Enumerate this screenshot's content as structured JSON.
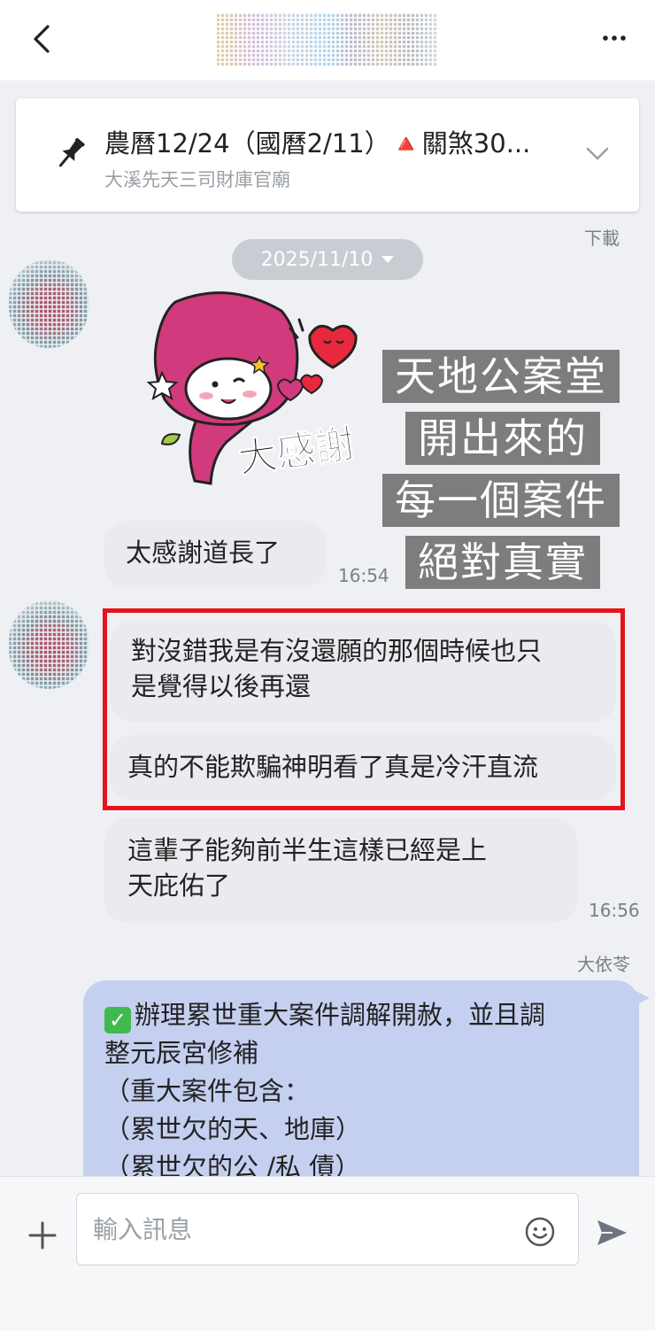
{
  "header": {
    "back_icon": "chevron-left-icon",
    "more_icon": "more-horizontal-icon"
  },
  "pinned": {
    "icon": "pin-icon",
    "title": "農曆12/24（國曆2/11）🔺關煞30...",
    "subtitle": "大溪先天三司財庫官廟",
    "expand_icon": "chevron-down-icon"
  },
  "download_label": "下載",
  "date_pill": "2025/11/10",
  "sticker_text": "大感謝",
  "caption": [
    "天地公案堂",
    "開出來的",
    "每一個案件",
    "絕對真實"
  ],
  "messages": [
    {
      "text": "太感謝道長了",
      "time": "16:54"
    },
    {
      "lines": [
        "對沒錯我是有沒還願的那個時候也只",
        "是覺得以後再還"
      ]
    },
    {
      "text": "真的不能欺騙神明看了真是冷汗直流"
    },
    {
      "lines": [
        "這輩子能夠前半生這樣已經是上",
        "天庇佑了"
      ],
      "time": "16:56"
    }
  ],
  "outgoing": {
    "sender": "大依苓",
    "lines": [
      "辦理累世重大案件調解開赦，並且調",
      "整元辰宮修補",
      "（重大案件包含：",
      "（累世欠的天、地庫）",
      "（累世欠的公 /私 債）"
    ]
  },
  "footer": {
    "placeholder": "輸入訊息",
    "plus_icon": "plus-icon",
    "emoji_icon": "emoji-icon",
    "send_icon": "send-icon"
  },
  "colors": {
    "accent_red": "#e4141b",
    "outgoing_bubble": "#c5cff0",
    "chat_bg": "#eef0f4",
    "caption_bg": "#7d7d7d",
    "sticker_pink": "#d23a7e"
  }
}
